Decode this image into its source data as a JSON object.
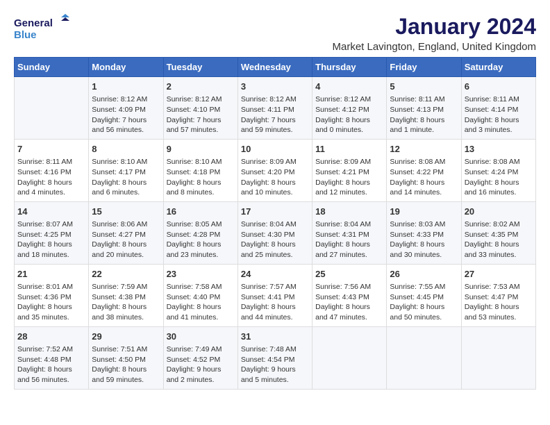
{
  "header": {
    "logo_line1": "General",
    "logo_line2": "Blue",
    "title": "January 2024",
    "subtitle": "Market Lavington, England, United Kingdom"
  },
  "weekdays": [
    "Sunday",
    "Monday",
    "Tuesday",
    "Wednesday",
    "Thursday",
    "Friday",
    "Saturday"
  ],
  "weeks": [
    [
      {
        "day": "",
        "info": ""
      },
      {
        "day": "1",
        "info": "Sunrise: 8:12 AM\nSunset: 4:09 PM\nDaylight: 7 hours\nand 56 minutes."
      },
      {
        "day": "2",
        "info": "Sunrise: 8:12 AM\nSunset: 4:10 PM\nDaylight: 7 hours\nand 57 minutes."
      },
      {
        "day": "3",
        "info": "Sunrise: 8:12 AM\nSunset: 4:11 PM\nDaylight: 7 hours\nand 59 minutes."
      },
      {
        "day": "4",
        "info": "Sunrise: 8:12 AM\nSunset: 4:12 PM\nDaylight: 8 hours\nand 0 minutes."
      },
      {
        "day": "5",
        "info": "Sunrise: 8:11 AM\nSunset: 4:13 PM\nDaylight: 8 hours\nand 1 minute."
      },
      {
        "day": "6",
        "info": "Sunrise: 8:11 AM\nSunset: 4:14 PM\nDaylight: 8 hours\nand 3 minutes."
      }
    ],
    [
      {
        "day": "7",
        "info": "Sunrise: 8:11 AM\nSunset: 4:16 PM\nDaylight: 8 hours\nand 4 minutes."
      },
      {
        "day": "8",
        "info": "Sunrise: 8:10 AM\nSunset: 4:17 PM\nDaylight: 8 hours\nand 6 minutes."
      },
      {
        "day": "9",
        "info": "Sunrise: 8:10 AM\nSunset: 4:18 PM\nDaylight: 8 hours\nand 8 minutes."
      },
      {
        "day": "10",
        "info": "Sunrise: 8:09 AM\nSunset: 4:20 PM\nDaylight: 8 hours\nand 10 minutes."
      },
      {
        "day": "11",
        "info": "Sunrise: 8:09 AM\nSunset: 4:21 PM\nDaylight: 8 hours\nand 12 minutes."
      },
      {
        "day": "12",
        "info": "Sunrise: 8:08 AM\nSunset: 4:22 PM\nDaylight: 8 hours\nand 14 minutes."
      },
      {
        "day": "13",
        "info": "Sunrise: 8:08 AM\nSunset: 4:24 PM\nDaylight: 8 hours\nand 16 minutes."
      }
    ],
    [
      {
        "day": "14",
        "info": "Sunrise: 8:07 AM\nSunset: 4:25 PM\nDaylight: 8 hours\nand 18 minutes."
      },
      {
        "day": "15",
        "info": "Sunrise: 8:06 AM\nSunset: 4:27 PM\nDaylight: 8 hours\nand 20 minutes."
      },
      {
        "day": "16",
        "info": "Sunrise: 8:05 AM\nSunset: 4:28 PM\nDaylight: 8 hours\nand 23 minutes."
      },
      {
        "day": "17",
        "info": "Sunrise: 8:04 AM\nSunset: 4:30 PM\nDaylight: 8 hours\nand 25 minutes."
      },
      {
        "day": "18",
        "info": "Sunrise: 8:04 AM\nSunset: 4:31 PM\nDaylight: 8 hours\nand 27 minutes."
      },
      {
        "day": "19",
        "info": "Sunrise: 8:03 AM\nSunset: 4:33 PM\nDaylight: 8 hours\nand 30 minutes."
      },
      {
        "day": "20",
        "info": "Sunrise: 8:02 AM\nSunset: 4:35 PM\nDaylight: 8 hours\nand 33 minutes."
      }
    ],
    [
      {
        "day": "21",
        "info": "Sunrise: 8:01 AM\nSunset: 4:36 PM\nDaylight: 8 hours\nand 35 minutes."
      },
      {
        "day": "22",
        "info": "Sunrise: 7:59 AM\nSunset: 4:38 PM\nDaylight: 8 hours\nand 38 minutes."
      },
      {
        "day": "23",
        "info": "Sunrise: 7:58 AM\nSunset: 4:40 PM\nDaylight: 8 hours\nand 41 minutes."
      },
      {
        "day": "24",
        "info": "Sunrise: 7:57 AM\nSunset: 4:41 PM\nDaylight: 8 hours\nand 44 minutes."
      },
      {
        "day": "25",
        "info": "Sunrise: 7:56 AM\nSunset: 4:43 PM\nDaylight: 8 hours\nand 47 minutes."
      },
      {
        "day": "26",
        "info": "Sunrise: 7:55 AM\nSunset: 4:45 PM\nDaylight: 8 hours\nand 50 minutes."
      },
      {
        "day": "27",
        "info": "Sunrise: 7:53 AM\nSunset: 4:47 PM\nDaylight: 8 hours\nand 53 minutes."
      }
    ],
    [
      {
        "day": "28",
        "info": "Sunrise: 7:52 AM\nSunset: 4:48 PM\nDaylight: 8 hours\nand 56 minutes."
      },
      {
        "day": "29",
        "info": "Sunrise: 7:51 AM\nSunset: 4:50 PM\nDaylight: 8 hours\nand 59 minutes."
      },
      {
        "day": "30",
        "info": "Sunrise: 7:49 AM\nSunset: 4:52 PM\nDaylight: 9 hours\nand 2 minutes."
      },
      {
        "day": "31",
        "info": "Sunrise: 7:48 AM\nSunset: 4:54 PM\nDaylight: 9 hours\nand 5 minutes."
      },
      {
        "day": "",
        "info": ""
      },
      {
        "day": "",
        "info": ""
      },
      {
        "day": "",
        "info": ""
      }
    ]
  ]
}
